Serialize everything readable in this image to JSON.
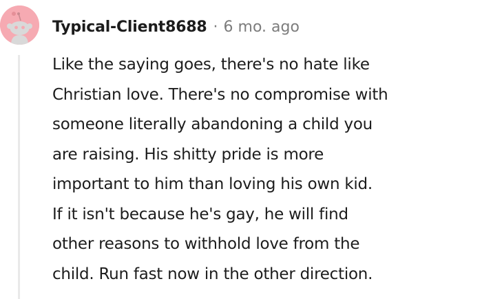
{
  "comment": {
    "avatar_icon": "reddit-snoo-avatar-icon",
    "avatar_color": "#f6aab2",
    "author": "Typical-Client8688",
    "separator": "·",
    "age": "6 mo. ago",
    "body_lines": [
      "Like the saying goes, there's no hate like",
      "Christian love. There's no compromise with",
      "someone literally abandoning a child you",
      "are raising. His shitty pride is more",
      "important to him than loving his own kid.",
      "If it isn't because he's gay, he will find",
      "other reasons to withhold love from the",
      "child. Run fast now in the other direction."
    ]
  }
}
